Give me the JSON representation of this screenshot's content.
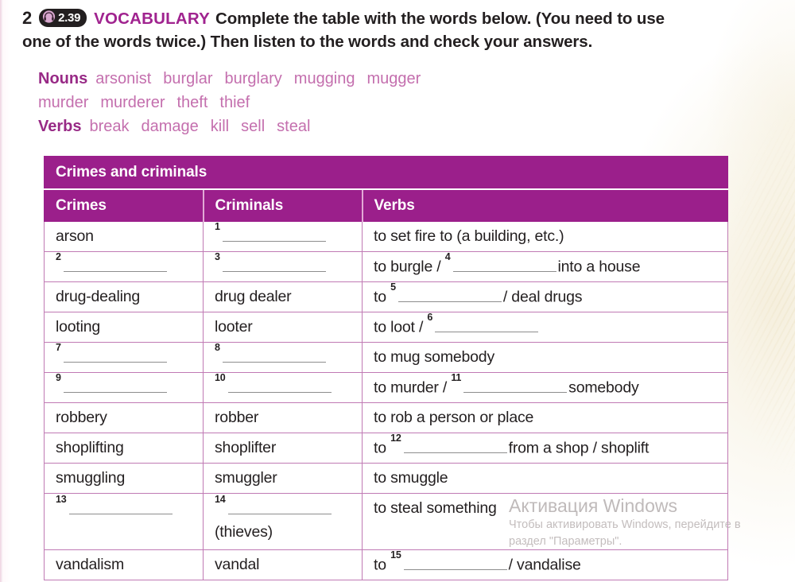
{
  "exercise": {
    "number": "2",
    "audio_badge": {
      "icon": "headphones-icon",
      "track": "2.39"
    },
    "label": "VOCABULARY",
    "instruction_line_1": "Complete the table with the words below. (You need to use",
    "instruction_line_2": "one of the words twice.) Then listen to the words and check your answers."
  },
  "word_bank": {
    "nouns_label": "Nouns",
    "nouns": [
      "arsonist",
      "burglar",
      "burglary",
      "mugging",
      "mugger",
      "murder",
      "murderer",
      "theft",
      "thief"
    ],
    "verbs_label": "Verbs",
    "verbs": [
      "break",
      "damage",
      "kill",
      "sell",
      "steal"
    ]
  },
  "table": {
    "title": "Crimes and criminals",
    "columns": [
      "Crimes",
      "Criminals",
      "Verbs"
    ],
    "rows": [
      {
        "crime": "arson",
        "crime_blank": null,
        "criminal": "",
        "criminal_blank": "1",
        "verb_prefix": "to set fire to (a building, etc.)",
        "verb_blank": null,
        "verb_suffix": ""
      },
      {
        "crime": "",
        "crime_blank": "2",
        "criminal": "",
        "criminal_blank": "3",
        "verb_prefix": "to burgle /",
        "verb_blank": "4",
        "verb_suffix": "into a house"
      },
      {
        "crime": "drug-dealing",
        "crime_blank": null,
        "criminal": "drug dealer",
        "criminal_blank": null,
        "verb_prefix": "to",
        "verb_blank": "5",
        "verb_suffix": "/ deal drugs"
      },
      {
        "crime": "looting",
        "crime_blank": null,
        "criminal": "looter",
        "criminal_blank": null,
        "verb_prefix": "to loot /",
        "verb_blank": "6",
        "verb_suffix": ""
      },
      {
        "crime": "",
        "crime_blank": "7",
        "criminal": "",
        "criminal_blank": "8",
        "verb_prefix": "to mug somebody",
        "verb_blank": null,
        "verb_suffix": ""
      },
      {
        "crime": "",
        "crime_blank": "9",
        "criminal": "",
        "criminal_blank": "10",
        "verb_prefix": "to murder /",
        "verb_blank": "11",
        "verb_suffix": "somebody"
      },
      {
        "crime": "robbery",
        "crime_blank": null,
        "criminal": "robber",
        "criminal_blank": null,
        "verb_prefix": "to rob a person or place",
        "verb_blank": null,
        "verb_suffix": ""
      },
      {
        "crime": "shoplifting",
        "crime_blank": null,
        "criminal": "shoplifter",
        "criminal_blank": null,
        "verb_prefix": "to",
        "verb_blank": "12",
        "verb_suffix": "from a shop / shoplift"
      },
      {
        "crime": "smuggling",
        "crime_blank": null,
        "criminal": "smuggler",
        "criminal_blank": null,
        "verb_prefix": "to smuggle",
        "verb_blank": null,
        "verb_suffix": ""
      },
      {
        "crime": "",
        "crime_blank": "13",
        "criminal": "",
        "criminal_blank": "14",
        "criminal_note": "(thieves)",
        "verb_prefix": "to steal something",
        "verb_blank": null,
        "verb_suffix": ""
      },
      {
        "crime": "vandalism",
        "crime_blank": null,
        "criminal": "vandal",
        "criminal_blank": null,
        "verb_prefix": "to",
        "verb_blank": "15",
        "verb_suffix": "/ vandalise"
      }
    ]
  },
  "watermark": {
    "title": "Активация Windows",
    "subtitle": "Чтобы активировать Windows, перейдите в раздел \"Параметры\"."
  },
  "colors": {
    "magenta": "#9b1f8b",
    "accent_pink": "#c46fae",
    "border": "#c07ab4",
    "text": "#231f20"
  }
}
